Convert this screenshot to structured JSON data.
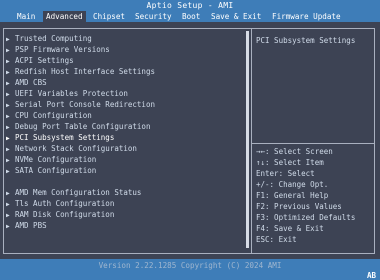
{
  "header": {
    "title": "Aptio Setup - AMI",
    "tabs": [
      {
        "label": "Main",
        "active": false
      },
      {
        "label": "Advanced",
        "active": true
      },
      {
        "label": "Chipset",
        "active": false
      },
      {
        "label": "Security",
        "active": false
      },
      {
        "label": "Boot",
        "active": false
      },
      {
        "label": "Save & Exit",
        "active": false
      },
      {
        "label": "Firmware Update",
        "active": false
      }
    ]
  },
  "menu": {
    "items": [
      {
        "label": "Trusted Computing",
        "selected": false
      },
      {
        "label": "PSP Firmware Versions",
        "selected": false
      },
      {
        "label": "ACPI Settings",
        "selected": false
      },
      {
        "label": "Redfish Host Interface Settings",
        "selected": false
      },
      {
        "label": "AMD CBS",
        "selected": false
      },
      {
        "label": "UEFI Variables Protection",
        "selected": false
      },
      {
        "label": "Serial Port Console Redirection",
        "selected": false
      },
      {
        "label": "CPU Configuration",
        "selected": false
      },
      {
        "label": "Debug Port Table Configuration",
        "selected": false
      },
      {
        "label": "PCI Subsystem Settings",
        "selected": true
      },
      {
        "label": "Network Stack Configuration",
        "selected": false
      },
      {
        "label": "NVMe Configuration",
        "selected": false
      },
      {
        "label": "SATA Configuration",
        "selected": false
      },
      {
        "label": "AMD Mem Configuration Status",
        "selected": false
      },
      {
        "label": "Tls Auth Configuration",
        "selected": false
      },
      {
        "label": "RAM Disk Configuration",
        "selected": false
      },
      {
        "label": "AMD PBS",
        "selected": false
      }
    ]
  },
  "help": {
    "text": "PCI Subsystem Settings"
  },
  "keys": [
    "→←: Select Screen",
    "↑↓: Select Item",
    "Enter: Select",
    "+/-: Change Opt.",
    "F1: General Help",
    "F2: Previous Values",
    "F3: Optimized Defaults",
    "F4: Save & Exit",
    "ESC: Exit"
  ],
  "footer": {
    "version": "Version 2.22.1285 Copyright (C) 2024 AMI",
    "badge": "AB"
  },
  "colors": {
    "background": "#3d4354",
    "titlebar": "#3e7db8",
    "text": "#d0dbe9",
    "selected_text": "#ffffff"
  }
}
